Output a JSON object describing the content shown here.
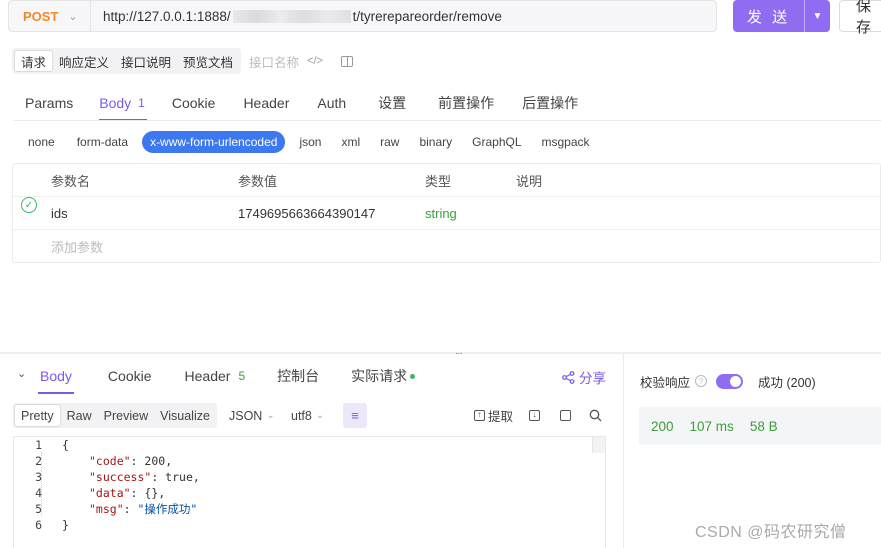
{
  "request": {
    "method": "POST",
    "url_prefix": "http://127.0.0.1:1888/",
    "url_suffix": "t/tyrerepareorder/remove",
    "send_label": "发 送",
    "save_label": "保 存"
  },
  "doc_tabs": {
    "items": [
      "请求",
      "响应定义",
      "接口说明",
      "预览文档"
    ],
    "active": "请求",
    "name_placeholder": "接口名称"
  },
  "request_tabs": [
    {
      "label": "Params"
    },
    {
      "label": "Body",
      "count": "1",
      "active": true
    },
    {
      "label": "Cookie"
    },
    {
      "label": "Header"
    },
    {
      "label": "Auth"
    },
    {
      "label": "设置"
    },
    {
      "label": "前置操作"
    },
    {
      "label": "后置操作"
    }
  ],
  "body_types": [
    "none",
    "form-data",
    "x-www-form-urlencoded",
    "json",
    "xml",
    "raw",
    "binary",
    "GraphQL",
    "msgpack"
  ],
  "body_type_active": "x-www-form-urlencoded",
  "params_table": {
    "headers": [
      "参数名",
      "参数值",
      "类型",
      "说明"
    ],
    "rows": [
      {
        "enabled": true,
        "name": "ids",
        "value": "1749695663664390147",
        "type": "string",
        "description": ""
      }
    ],
    "add_placeholder": "添加参数"
  },
  "response_tabs": [
    {
      "label": "Body",
      "active": true
    },
    {
      "label": "Cookie"
    },
    {
      "label": "Header",
      "count": "5"
    },
    {
      "label": "控制台"
    },
    {
      "label": "实际请求",
      "dot": true
    }
  ],
  "share_label": "分享",
  "view_tabs": [
    "Pretty",
    "Raw",
    "Preview",
    "Visualize"
  ],
  "view_active": "Pretty",
  "format": "JSON",
  "encoding": "utf8",
  "extract_label": "提取",
  "code_lines": [
    {
      "num": "1",
      "text": "{"
    },
    {
      "num": "2",
      "key": "\"code\"",
      "val": "200",
      "trail": ","
    },
    {
      "num": "3",
      "key": "\"success\"",
      "val": "true",
      "trail": ","
    },
    {
      "num": "4",
      "key": "\"data\"",
      "val": "{}",
      "trail": ","
    },
    {
      "num": "5",
      "key": "\"msg\"",
      "str": "\"操作成功\"",
      "trail": ""
    },
    {
      "num": "6",
      "text": "}"
    }
  ],
  "verify": {
    "label": "校验响应",
    "enabled": true,
    "result": "成功 (200)"
  },
  "stats": {
    "status": "200",
    "time": "107 ms",
    "size": "58 B"
  },
  "watermark": "CSDN @码农研究僧",
  "colors": {
    "accent": "#8f6cf1",
    "method": "#f08a24",
    "success": "#3b9f3b",
    "body_type_active": "#3c78f0"
  }
}
